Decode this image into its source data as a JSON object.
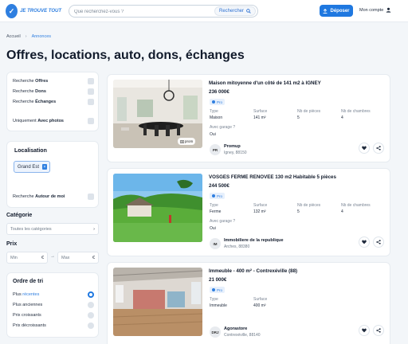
{
  "header": {
    "logo_text": "JE TROUVE TOUT",
    "search_placeholder": "Que recherchez-vous ?",
    "search_button": "Rechercher",
    "post_button": "Déposer",
    "account_label": "Mon compte"
  },
  "breadcrumb": {
    "home": "Accueil",
    "current": "Annonces"
  },
  "page_title": "Offres, locations, auto, dons, échanges",
  "filters": {
    "search_offers_prefix": "Recherche ",
    "search_offers_bold": "Offres",
    "search_dons_prefix": "Recherche ",
    "search_dons_bold": "Dons",
    "search_echanges_prefix": "Recherche ",
    "search_echanges_bold": "Échanges",
    "photos_prefix": "Uniquement ",
    "photos_bold": "Avec photos"
  },
  "location": {
    "title": "Localisation",
    "chip": "Grand Est",
    "chip_remove": "×",
    "around_prefix": "Recherche ",
    "around_bold": "Autour de moi"
  },
  "category": {
    "title": "Catégorie",
    "value": "Toutes les catégories"
  },
  "price": {
    "title": "Prix",
    "min": "Min",
    "max": "Max",
    "currency": "€",
    "arrow": "→"
  },
  "sort": {
    "title": "Ordre de tri",
    "options": [
      {
        "prefix": "Plus ",
        "highlight": "récentes",
        "selected": true
      },
      {
        "prefix": "Plus anciennes",
        "highlight": "",
        "selected": false
      },
      {
        "prefix": "Prix croissants",
        "highlight": "",
        "selected": false
      },
      {
        "prefix": "Prix décroissants",
        "highlight": "",
        "selected": false
      }
    ]
  },
  "listings": [
    {
      "title": "Maison mitoyenne d'un côté de 141 m2 à IGNEY",
      "price": "236 000€",
      "badge": "Pro",
      "photo_tag": "prom",
      "attrs": [
        {
          "label": "Type",
          "value": "Maison"
        },
        {
          "label": "Surface",
          "value": "141 m²"
        },
        {
          "label": "Nb de pièces",
          "value": "5"
        },
        {
          "label": "Nb de chambres",
          "value": "4"
        }
      ],
      "extra_label": "Avec garage ?",
      "extra_value": "Oui",
      "seller_initials": "PR",
      "seller_name": "Promup",
      "seller_location": "Igney, 88150"
    },
    {
      "title": "VOSGES FERME RENOVEE 130 m2 Habitable 5 pièces",
      "price": "244 500€",
      "badge": "Pro",
      "attrs": [
        {
          "label": "Type",
          "value": "Ferme"
        },
        {
          "label": "Surface",
          "value": "132 m²"
        },
        {
          "label": "Nb de pièces",
          "value": "5"
        },
        {
          "label": "Nb de chambres",
          "value": "4"
        }
      ],
      "extra_label": "Avec garage ?",
      "extra_value": "Oui",
      "seller_initials": "IM",
      "seller_name": "Immobiliere de la republique",
      "seller_location": "Arches, 88380"
    },
    {
      "title": "Immeuble - 400 m² - Contrexéville (88)",
      "price": "21 000€",
      "badge": "Pro",
      "attrs": [
        {
          "label": "Type",
          "value": "Immeuble"
        },
        {
          "label": "Surface",
          "value": "400 m²"
        }
      ],
      "seller_initials": "DRJ",
      "seller_name": "Agorastore",
      "seller_location": "Contrexéville, 88140"
    }
  ],
  "colors": {
    "accent": "#1f78e0",
    "background": "#f3f6f9",
    "card": "#ffffff"
  },
  "icons": [
    "search-icon",
    "upload-icon",
    "user-icon",
    "chevron-right-icon",
    "heart-icon",
    "share-icon",
    "camera-icon"
  ]
}
